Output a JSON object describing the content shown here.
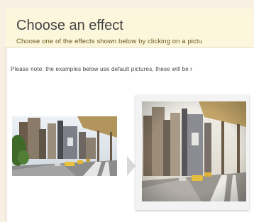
{
  "header": {
    "title": "Choose an effect",
    "subtitle": "Choose one of the effects shown below by clicking on a pictu"
  },
  "note": "Please note: the examples below use default pictures, these will be r",
  "images": {
    "original": {
      "icon": "city-street-photo-icon"
    },
    "effect": {
      "icon": "city-street-photo-icon"
    },
    "arrow": {
      "icon": "arrow-right-icon"
    }
  },
  "colors": {
    "background": "#f9f0e4",
    "header": "#fbf6dc",
    "subtitle_text": "#6a5a1c",
    "arrow": "#d8d8d8"
  }
}
